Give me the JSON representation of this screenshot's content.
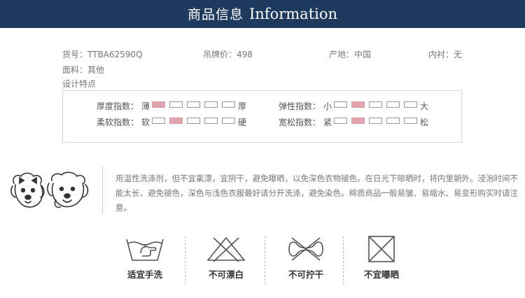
{
  "header": {
    "title_cn": "商品信息",
    "title_en": "Information"
  },
  "info": {
    "item_no": "货号：TTBA62590Q",
    "tag_price": "吊牌价：498",
    "origin": "产地：中国",
    "lining": "内衬：无",
    "fabric": "面料：其他",
    "design": "设计特点"
  },
  "scales": [
    {
      "label": "厚度指数：",
      "low": "薄",
      "high": "厚",
      "level": 1
    },
    {
      "label": "弹性指数：",
      "low": "小",
      "high": "大",
      "level": 2
    },
    {
      "label": "柔软指数：",
      "low": "软",
      "high": "硬",
      "level": 2
    },
    {
      "label": "宽松指数：",
      "low": "紧",
      "high": "松",
      "level": 2
    }
  ],
  "wash_text": "用温性洗涤剂，但不宜氯漂，宜阴干，避免曝晒，以免深色衣物褪色。在日光下晾晒时，将内里朝外。浸泡时间不能太长，避免褪色，深色与浅色衣服最好请分开洗涤，避免染色。棉质商品一般易皱、易缩水、易变形购买时请注意。",
  "care": [
    {
      "icon": "hand-wash-icon",
      "label": "适宜手洗"
    },
    {
      "icon": "no-bleach-icon",
      "label": "不可漂白"
    },
    {
      "icon": "no-wring-icon",
      "label": "不可拧干"
    },
    {
      "icon": "no-sun-dry-icon",
      "label": "不宜曝晒"
    }
  ]
}
